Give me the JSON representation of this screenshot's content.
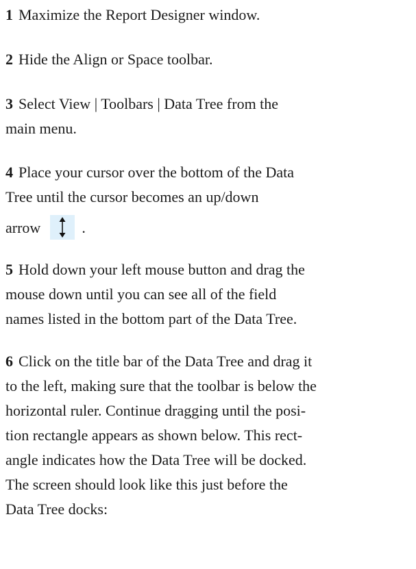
{
  "steps": [
    {
      "num": "1",
      "text": "Maximize the Report Designer window."
    },
    {
      "num": "2",
      "text": "Hide the Align or Space toolbar."
    },
    {
      "num": "3",
      "line1": "Select View | Toolbars | Data Tree from the",
      "line2": "main menu."
    },
    {
      "num": "4",
      "line1": "Place your cursor over the bottom of the Data",
      "line2": "Tree until the cursor becomes an up/down",
      "line3_prefix": "arrow",
      "line3_suffix": ".",
      "icon": "up-down-arrow-icon"
    },
    {
      "num": "5",
      "line1": "Hold down your left mouse button and drag the",
      "line2": "mouse down until you can see all of the field",
      "line3": "names listed in the bottom part of the Data Tree."
    },
    {
      "num": "6",
      "line1": "Click on the title bar of the Data Tree and drag it",
      "line2": "to the left, making sure that the toolbar is below the",
      "line3": "horizontal ruler.  Continue dragging until the posi-",
      "line4": "tion rectangle appears as shown below.  This rect-",
      "line5": "angle indicates how the Data Tree will be docked.",
      "line6": "The screen should look like this just before the",
      "line7": "Data Tree docks:"
    }
  ]
}
